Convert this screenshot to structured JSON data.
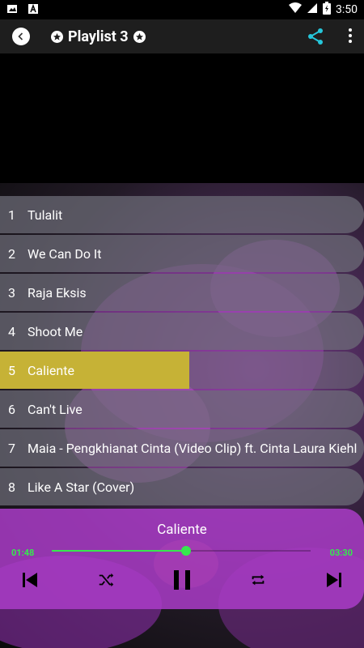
{
  "status": {
    "time": "3:50",
    "left_icons": [
      "image-icon",
      "font-icon"
    ],
    "right_icons": [
      "wifi-icon",
      "signal-icon",
      "battery-icon"
    ]
  },
  "app_bar": {
    "title": "Playlist 3",
    "back_icon": "chevron-left-icon",
    "share_icon": "share-icon",
    "more_icon": "more-vert-icon"
  },
  "tracks": [
    {
      "num": "1",
      "name": "Tulalit"
    },
    {
      "num": "2",
      "name": "We Can Do It"
    },
    {
      "num": "3",
      "name": "Raja Eksis"
    },
    {
      "num": "4",
      "name": "Shoot Me"
    },
    {
      "num": "5",
      "name": "Caliente",
      "active": true,
      "progress": 0.52
    },
    {
      "num": "6",
      "name": "Can't Live"
    },
    {
      "num": "7",
      "name": "Maia - Pengkhianat Cinta (Video Clip) ft. Cinta Laura Kiehl"
    },
    {
      "num": "8",
      "name": "Like A Star (Cover)"
    }
  ],
  "player": {
    "title": "Caliente",
    "elapsed": "01:48",
    "duration": "03:30",
    "progress": 0.52,
    "controls": [
      "skip-previous-icon",
      "shuffle-icon",
      "pause-icon",
      "repeat-icon",
      "skip-next-icon"
    ]
  },
  "colors": {
    "accent_green": "#36e84e",
    "share_teal": "#26c6da",
    "active_track": "#c6b236",
    "player_bg": "#aa3cc8"
  }
}
